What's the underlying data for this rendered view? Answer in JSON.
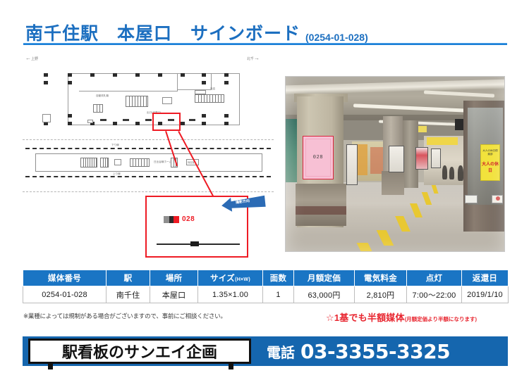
{
  "header": {
    "title": "南千住駅　本屋口　サインボード",
    "code": "(0254-01-028)"
  },
  "map": {
    "direction_left": "上野",
    "direction_right": "北千",
    "labels": {
      "ticket_gate": "自動改札機",
      "exit": "出口(本屋口)",
      "kiosk": "売店",
      "stairs_down": "下り線",
      "stairs_up": "上り線",
      "platform": "日比谷線ホーム",
      "escalator": "階段",
      "waiting": "待合室"
    },
    "callout": {
      "marker_number": "028",
      "shoot_direction": "撮影方向"
    }
  },
  "photo": {
    "sign_number": "028",
    "banner_text": "大人の休日",
    "banner_sub": "大人の休日倶楽部"
  },
  "table": {
    "headers": [
      {
        "label": "媒体番号",
        "sub": ""
      },
      {
        "label": "駅",
        "sub": ""
      },
      {
        "label": "場所",
        "sub": ""
      },
      {
        "label": "サイズ",
        "sub": "(H×W)"
      },
      {
        "label": "面数",
        "sub": ""
      },
      {
        "label": "月額定価",
        "sub": ""
      },
      {
        "label": "電気料金",
        "sub": ""
      },
      {
        "label": "点灯",
        "sub": ""
      },
      {
        "label": "返還日",
        "sub": ""
      }
    ],
    "rows": [
      [
        "0254-01-028",
        "南千住",
        "本屋口",
        "1.35×1.00",
        "1",
        "63,000円",
        "2,810円",
        "7:00～22:00",
        "2019/1/10"
      ]
    ]
  },
  "notes": {
    "left": "※業種によっては規制がある場合がございますので、事前にご相談ください。",
    "right_main": "☆1基でも半額媒体",
    "right_sub": "(月額定価より半額になります)"
  },
  "footer": {
    "logo": "駅看板のサンエイ企画",
    "phone_label": "電話",
    "phone_number": "03-3355-3325"
  },
  "colors": {
    "brand_blue": "#1a75c4",
    "title_blue": "#1c6fc0",
    "footer_blue": "#1566ae",
    "accent_red": "#e8252f",
    "highlight_pink": "#f7c0d4"
  }
}
